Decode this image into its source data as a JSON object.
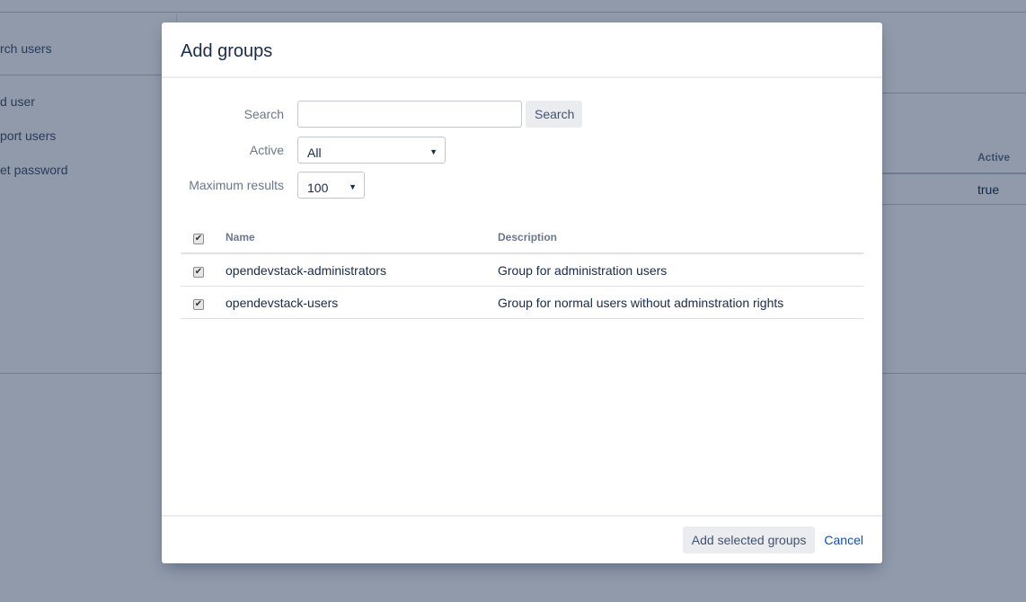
{
  "background": {
    "sidebar_items": [
      {
        "label": "rch users"
      },
      {
        "label": "d user"
      },
      {
        "label": "port users"
      },
      {
        "label": "et password"
      }
    ],
    "table": {
      "column_header": "Active",
      "cell": "true"
    }
  },
  "dialog": {
    "title": "Add groups",
    "form": {
      "search_label": "Search",
      "search_value": "",
      "search_placeholder": "",
      "search_button": "Search",
      "active_label": "Active",
      "active_selected": "All",
      "max_results_label": "Maximum results",
      "max_results_selected": "100"
    },
    "table": {
      "headers": {
        "select_all_checked": true,
        "name": "Name",
        "description": "Description"
      },
      "rows": [
        {
          "checked": true,
          "name": "opendevstack-administrators",
          "description": "Group for administration users"
        },
        {
          "checked": true,
          "name": "opendevstack-users",
          "description": "Group for normal users without adminstration rights"
        }
      ]
    },
    "footer": {
      "submit_label": "Add selected groups",
      "cancel_label": "Cancel"
    }
  },
  "icons": {
    "check": "✔",
    "caret": "▼"
  },
  "colors": {
    "overlay": "#091e42",
    "link": "#0052cc",
    "title": "#172b4d",
    "label": "#6b778c"
  }
}
